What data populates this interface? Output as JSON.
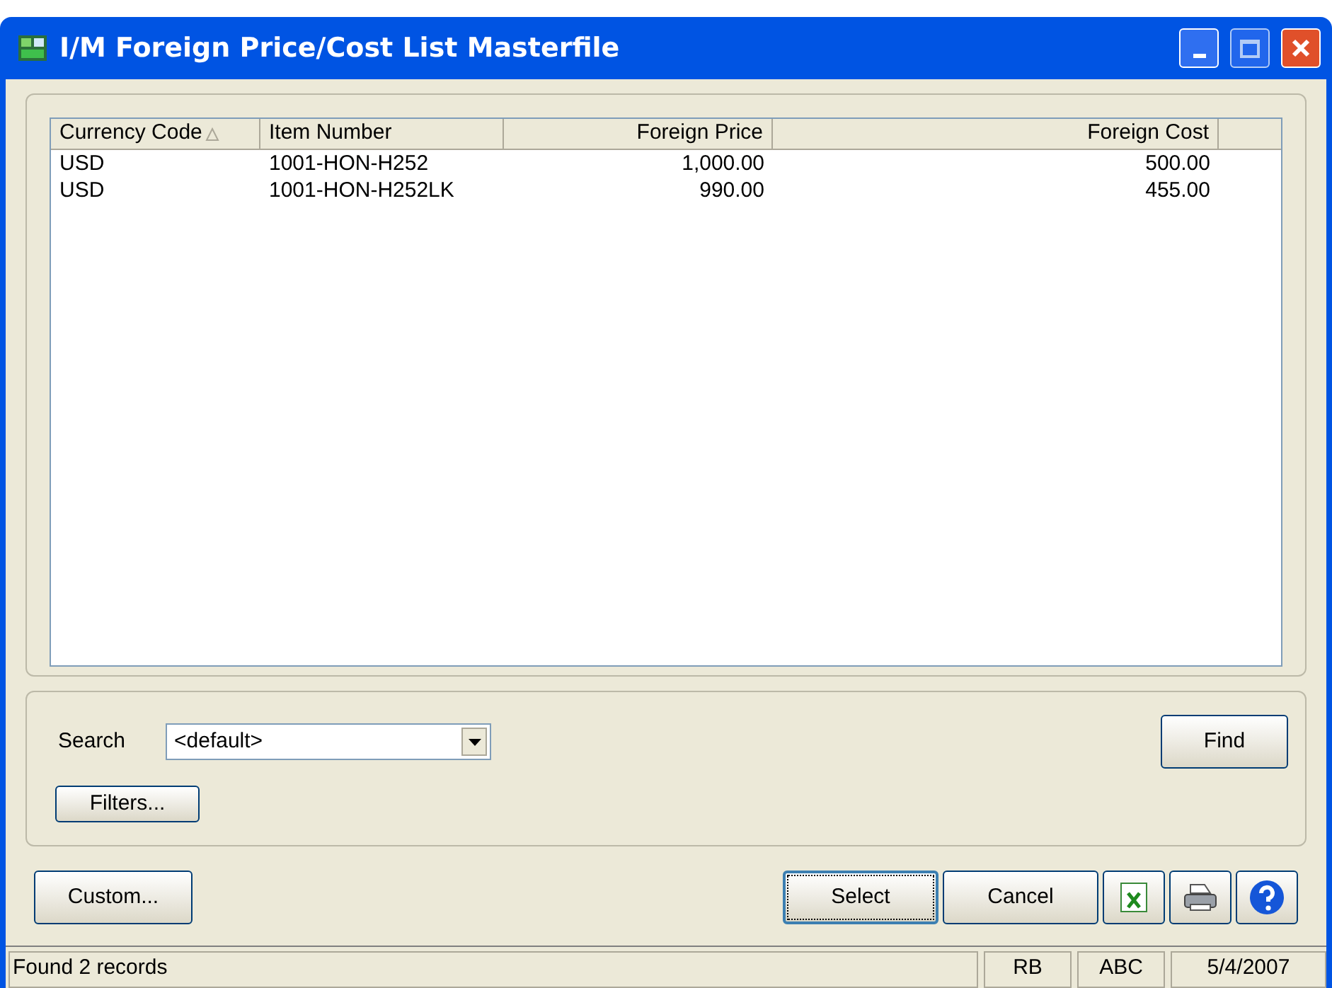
{
  "window": {
    "title": "I/M Foreign Price/Cost List Masterfile"
  },
  "table": {
    "columns": [
      {
        "label": "Currency Code",
        "kind": "text",
        "sorted": true
      },
      {
        "label": "Item Number",
        "kind": "text",
        "sorted": false
      },
      {
        "label": "Foreign Price",
        "kind": "amount",
        "sorted": false
      },
      {
        "label": "Foreign Cost",
        "kind": "amount",
        "sorted": false
      }
    ],
    "rows": [
      [
        "USD",
        "1001-HON-H252",
        "1,000.00",
        "500.00"
      ],
      [
        "USD",
        "1001-HON-H252LK",
        "990.00",
        "455.00"
      ]
    ]
  },
  "search": {
    "label": "Search",
    "value": "<default>"
  },
  "find_button": "Find",
  "filters_button": "Filters...",
  "custom_button": "Custom...",
  "buttons": [
    {
      "label": "Select",
      "selected": true
    },
    {
      "label": "Cancel",
      "selected": false
    }
  ],
  "status_bar": {
    "message": "Found 2 records",
    "cells": [
      "RB",
      "ABC",
      "5/4/2007"
    ]
  }
}
